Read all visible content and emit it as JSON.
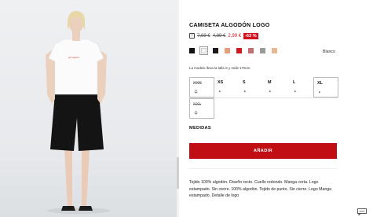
{
  "product": {
    "title": "CAMISETA ALGODÓN LOGO",
    "info_icon": "info-square-icon",
    "price_old_1": "7,99 €",
    "price_old_2": "4,99 €",
    "price_new": "2,99 €",
    "discount": "-63 %",
    "selected_color_name": "Blanco",
    "swatches": [
      {
        "color": "#111111",
        "name": "black"
      },
      {
        "color": "#f4f4f4",
        "name": "white"
      },
      {
        "color": "#1a1a1a",
        "name": "black-2"
      },
      {
        "color": "#e3a07a",
        "name": "orange-pattern"
      },
      {
        "color": "#d21820",
        "name": "red"
      },
      {
        "color": "#c07070",
        "name": "red-pattern"
      },
      {
        "color": "#9a9a9a",
        "name": "grey"
      },
      {
        "color": "#e8b890",
        "name": "peach-pattern"
      }
    ],
    "model_note": "La modelo lleva la talla S y mide 175cm.",
    "sizes": [
      {
        "label": "XXS",
        "state": "notify"
      },
      {
        "label": "XS",
        "state": "available"
      },
      {
        "label": "S",
        "state": "available"
      },
      {
        "label": "M",
        "state": "available"
      },
      {
        "label": "L",
        "state": "available"
      },
      {
        "label": "XL",
        "state": "available"
      },
      {
        "label": "XXL",
        "state": "notify"
      }
    ],
    "measurements_label": "MEDIDAS",
    "add_button_label": "AÑADIR",
    "description": "Tejido 100% algodón. Diseño recto. Cuello redondo. Manga corta. Logo estampado. Sin cierre. 100% algodón. Tejido de punto. Sin cierre. Logo Manga estampado. Detalle de logo",
    "accent_color": "#c00e14"
  },
  "chat_icon": "chat-icon"
}
